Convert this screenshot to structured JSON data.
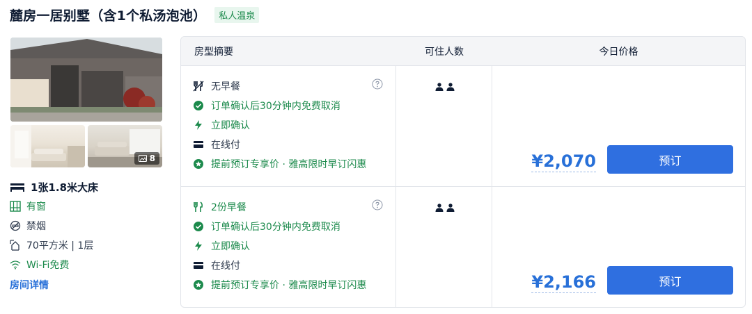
{
  "room": {
    "title": "麓房一居别墅（含1个私汤泡池）",
    "tag": "私人温泉"
  },
  "gallery": {
    "photo_count": "8"
  },
  "facilities": {
    "bed": "1张1.8米大床",
    "window": "有窗",
    "smoking": "禁烟",
    "area_floor": "70平方米 | 1层",
    "wifi": "Wi-Fi免费",
    "details_link": "房间详情"
  },
  "table": {
    "headers": {
      "summary": "房型摘要",
      "occupancy": "可住人数",
      "price": "今日价格"
    },
    "rows": [
      {
        "meal": "无早餐",
        "cancel": "订单确认后30分钟内免费取消",
        "confirm": "立即确认",
        "payment": "在线付",
        "promo": "提前预订专享价 · 雅高限时早订闪惠",
        "price": "¥2,070",
        "book_label": "预订"
      },
      {
        "meal": "2份早餐",
        "cancel": "订单确认后30分钟内免费取消",
        "confirm": "立即确认",
        "payment": "在线付",
        "promo": "提前预订专享价 · 雅高限时早订闪惠",
        "price": "¥2,166",
        "book_label": "预订"
      }
    ]
  },
  "colors": {
    "accent": "#2f6fe0",
    "price": "#2870d8",
    "green": "#1c8a4c"
  }
}
